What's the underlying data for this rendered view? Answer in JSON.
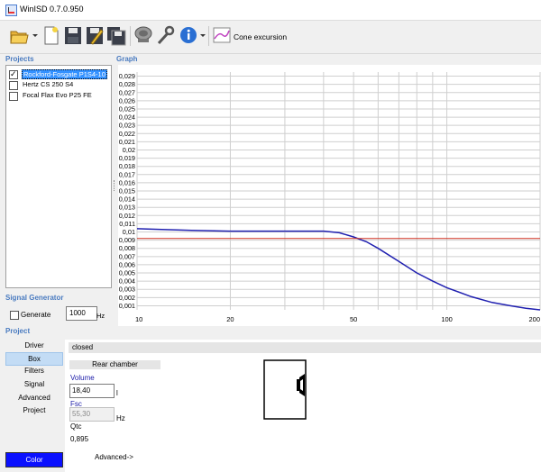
{
  "window": {
    "title": "WinISD 0.7.0.950"
  },
  "toolbar": {
    "cone_excursion_label": "Cone excursion"
  },
  "projects": {
    "label": "Projects",
    "items": [
      {
        "name": "Rockford-Fosgate P1S4-10",
        "checked": true,
        "selected": true
      },
      {
        "name": "Hertz CS 250 S4",
        "checked": false,
        "selected": false
      },
      {
        "name": "Focal Flax Evo P25 FE",
        "checked": false,
        "selected": false
      }
    ]
  },
  "graph": {
    "label": "Graph"
  },
  "signal_generator": {
    "label": "Signal Generator",
    "generate_label": "Generate",
    "frequency_value": "1000",
    "unit": "Hz"
  },
  "project_panel": {
    "label": "Project",
    "nav": [
      "Driver",
      "Box",
      "Filters",
      "Signal",
      "Advanced",
      "Project"
    ],
    "selected_nav": "Box",
    "color_label": "Color",
    "color_value": "#0a10ff"
  },
  "box": {
    "type": "closed",
    "rear_chamber_header": "Rear chamber",
    "volume_label": "Volume",
    "volume_value": "18,40",
    "volume_unit": "l",
    "fsc_label": "Fsc",
    "fsc_value": "55,30",
    "fsc_unit": "Hz",
    "qtc_label": "Qtc",
    "qtc_value": "0,895",
    "advanced_label": "Advanced->"
  },
  "chart_data": {
    "type": "line",
    "title": "",
    "xlabel": "",
    "ylabel": "",
    "x_scale": "log",
    "xlim": [
      10,
      200
    ],
    "ylim": [
      0.0005,
      0.0295
    ],
    "x_tick_labels": [
      "10",
      "20",
      "50",
      "100",
      "200"
    ],
    "y_tick_labels": [
      "0,029",
      "0,028",
      "0,027",
      "0,026",
      "0,025",
      "0,024",
      "0,023",
      "0,022",
      "0,021",
      "0,02",
      "0,019",
      "0,018",
      "0,017",
      "0,016",
      "0,015",
      "0,014",
      "0,013",
      "0,012",
      "0,011",
      "0,01",
      "0,009",
      "0,008",
      "0,007",
      "0,006",
      "0,005",
      "0,004",
      "0,003",
      "0,002",
      "0,001"
    ],
    "grid": true,
    "series": [
      {
        "color": "#2020b0",
        "x": [
          10,
          12,
          15,
          20,
          25,
          30,
          35,
          40,
          45,
          50,
          55,
          60,
          70,
          80,
          90,
          100,
          120,
          140,
          160,
          180,
          200
        ],
        "values": [
          0.0104,
          0.0103,
          0.0102,
          0.0101,
          0.0101,
          0.0101,
          0.0101,
          0.0101,
          0.0099,
          0.0094,
          0.0088,
          0.008,
          0.0064,
          0.005,
          0.004,
          0.0032,
          0.0021,
          0.0014,
          0.001,
          0.0007,
          0.0005
        ]
      },
      {
        "color": "#d03020",
        "x": [
          10,
          200
        ],
        "values": [
          0.0092,
          0.0092
        ]
      }
    ]
  }
}
